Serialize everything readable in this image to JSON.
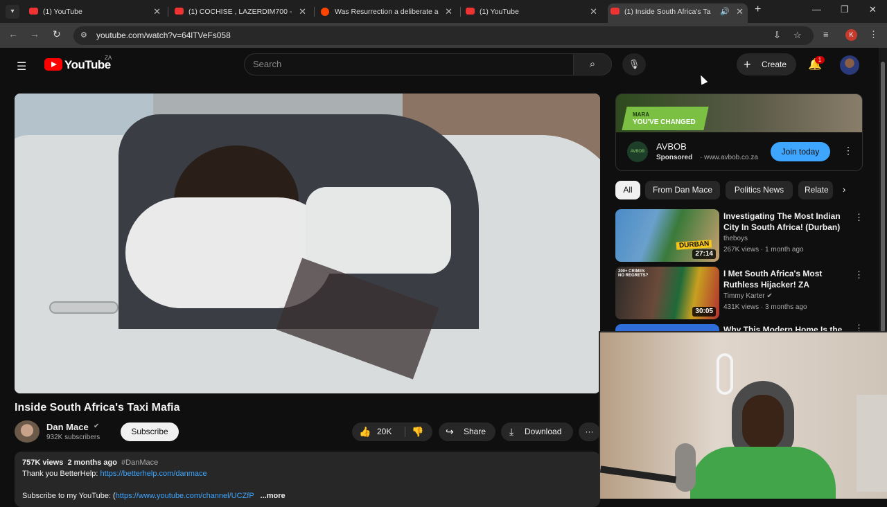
{
  "browser": {
    "tabs": [
      {
        "title": "(1) YouTube",
        "favicon": "youtube-icon"
      },
      {
        "title": "(1) COCHISE , LAZERDIM700 - ",
        "favicon": "youtube-icon"
      },
      {
        "title": "Was Resurrection a deliberate a",
        "favicon": "reddit-icon"
      },
      {
        "title": "(1) YouTube",
        "favicon": "youtube-icon"
      },
      {
        "title": "(1) Inside South Africa's Ta",
        "favicon": "youtube-icon",
        "active": true
      }
    ],
    "url": "youtube.com/watch?v=64lTVeFs058",
    "profile_initial": "K"
  },
  "youtube": {
    "logo_text": "YouTube",
    "country_code": "ZA",
    "search_placeholder": "Search",
    "create_label": "Create",
    "notification_count": "1"
  },
  "video": {
    "title": "Inside South Africa's Taxi Mafia",
    "channel": "Dan Mace",
    "subscribers": "932K subscribers",
    "subscribe_label": "Subscribe",
    "likes": "20K",
    "share_label": "Share",
    "download_label": "Download",
    "views": "757K views",
    "age": "2 months ago",
    "hashtag": "#DanMace",
    "desc_line1_text": "Thank you BetterHelp: ",
    "desc_line1_link": "https://betterhelp.com/danmace",
    "desc_line2_text": "Subscribe to my YouTube: (",
    "desc_line2_link": "https://www.youtube.com/channel/UCZfP",
    "more_label": "...more"
  },
  "ad": {
    "banner_line1": "MARA",
    "banner_line2": "YOU'VE CHANGED",
    "logo_text": "AVBOB",
    "name": "AVBOB",
    "sponsored": "Sponsored",
    "domain": "· www.avbob.co.za",
    "cta": "Join today"
  },
  "chips": [
    "All",
    "From Dan Mace",
    "Politics News",
    "Relate"
  ],
  "recommendations": [
    {
      "title": "Investigating The Most Indian City In South Africa! (Durban)",
      "channel": "theboys",
      "meta": "267K views · 1 month ago",
      "duration": "27:14"
    },
    {
      "title": "I Met South Africa's Most Ruthless Hijacker! ZA",
      "channel": "Timmy Karter ✔",
      "meta": "431K views · 3 months ago",
      "duration": "30:05"
    },
    {
      "title": "Why This Modern Home Is the",
      "channel": "",
      "meta": "",
      "duration": ""
    }
  ]
}
